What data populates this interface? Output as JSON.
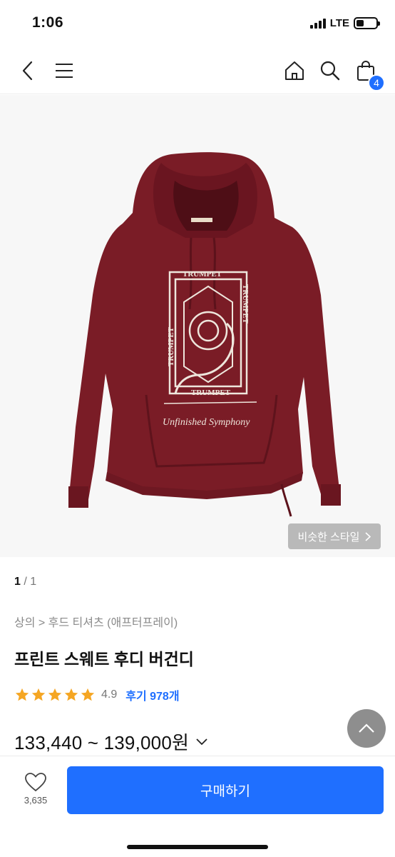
{
  "status": {
    "time": "1:06",
    "network": "LTE"
  },
  "nav": {
    "cart_count": "4"
  },
  "product_image": {
    "print_top": "TRUMPET",
    "print_bottom": "TRUMPET",
    "print_side_left": "TRUMPET",
    "print_side_right": "TRUMPET",
    "print_caption": "Unfinished Symphony",
    "garment_color": "#7a1c26"
  },
  "similar_style": {
    "label": "비슷한 스타일"
  },
  "pager": {
    "current": "1",
    "total": "/ 1"
  },
  "breadcrumb": "상의 > 후드 티셔츠 (애프터프레이)",
  "title": "프린트 스웨트 후디 버건디",
  "rating": {
    "value": "4.9",
    "stars": 5,
    "reviews": "후기 978개"
  },
  "price": "133,440 ~ 139,000원",
  "like_count": "3,635",
  "buy_label": "구매하기",
  "colors": {
    "accent": "#1f6fff",
    "star": "#f5a623"
  }
}
